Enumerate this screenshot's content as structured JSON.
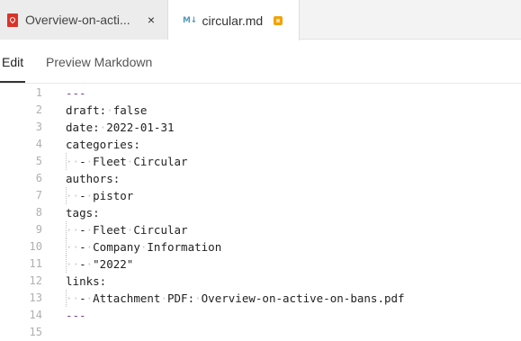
{
  "tabs": [
    {
      "label": "Overview-on-active-on-bans.pdf",
      "display": "Overview-on-acti...",
      "icon": "pdf-icon",
      "close": "×"
    },
    {
      "label": "circular.md",
      "icon_text": "M↓",
      "icon": "markdown-icon",
      "modified": true
    }
  ],
  "subtabs": {
    "edit": "Edit",
    "preview": "Preview Markdown"
  },
  "colors": {
    "accent": "#f0a30a",
    "pdf": "#d9342b",
    "markdown": "#519aba",
    "frontmatter": "#7a3e9d"
  },
  "editor": {
    "lines": [
      {
        "n": "1",
        "text": "---"
      },
      {
        "n": "2",
        "text": "draft:·false"
      },
      {
        "n": "3",
        "text": "date:·2022-01-31"
      },
      {
        "n": "4",
        "text": "categories:"
      },
      {
        "n": "5",
        "text": "··-·Fleet·Circular"
      },
      {
        "n": "6",
        "text": "authors:"
      },
      {
        "n": "7",
        "text": "··-·pistor"
      },
      {
        "n": "8",
        "text": "tags:"
      },
      {
        "n": "9",
        "text": "··-·Fleet·Circular"
      },
      {
        "n": "10",
        "text": "··-·Company·Information"
      },
      {
        "n": "11",
        "text": "··-·\"2022\""
      },
      {
        "n": "12",
        "text": "links:"
      },
      {
        "n": "13",
        "text": "··-·Attachment·PDF:·Overview-on-active-on-bans.pdf"
      },
      {
        "n": "14",
        "text": "---"
      },
      {
        "n": "15",
        "text": ""
      }
    ]
  }
}
